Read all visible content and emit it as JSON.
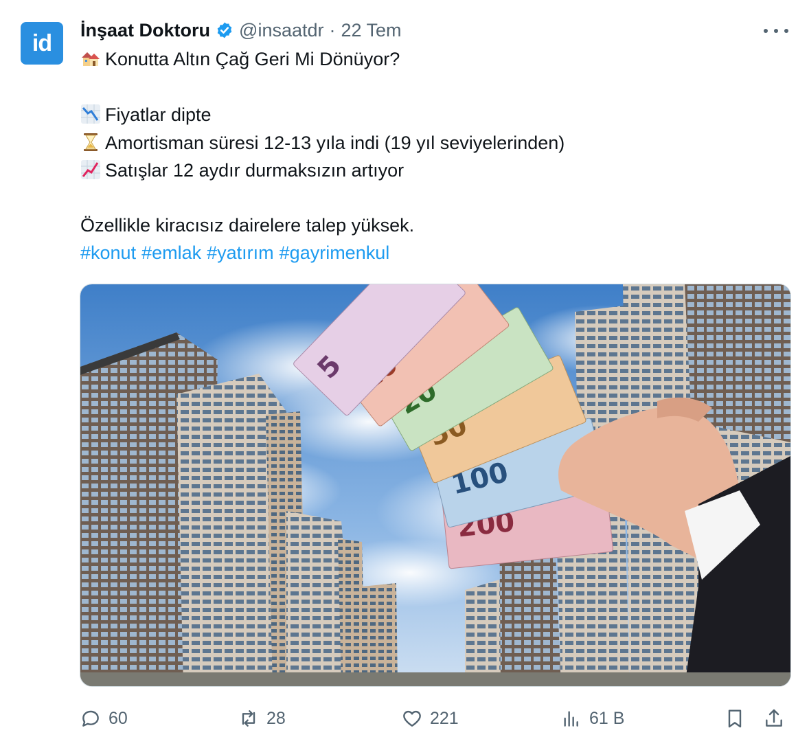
{
  "author": {
    "avatar_text": "id",
    "name": "İnşaat Doktoru",
    "handle": "@insaatdr",
    "separator": "·",
    "date": "22 Tem",
    "verified_icon": "verified-badge-icon",
    "more_icon": "more-icon"
  },
  "post": {
    "line1": "Konutta Altın Çağ Geri Mi Dönüyor?",
    "line1_icon": "houses-emoji",
    "bullets": [
      {
        "icon": "chart-decreasing-emoji",
        "text": "Fiyatlar dipte"
      },
      {
        "icon": "hourglass-emoji",
        "text": "Amortisman süresi 12-13 yıla indi (19 yıl seviyelerinden)"
      },
      {
        "icon": "chart-increasing-emoji",
        "text": "Satışlar 12 aydır durmaksızın artıyor"
      }
    ],
    "line5": "Özellikle kiracısız dairelere talep yüksek.",
    "hashtags": [
      "#konut",
      "#emlak",
      "#yatırım",
      "#gayrimenkul"
    ]
  },
  "media": {
    "banknote_values": [
      "5",
      "10",
      "20",
      "50",
      "100",
      "200"
    ]
  },
  "actions": {
    "replies": "60",
    "reposts": "28",
    "likes": "221",
    "views": "61 B"
  },
  "colors": {
    "accent": "#1d9bf0",
    "muted": "#536471",
    "avatar": "#2a8fe0"
  }
}
